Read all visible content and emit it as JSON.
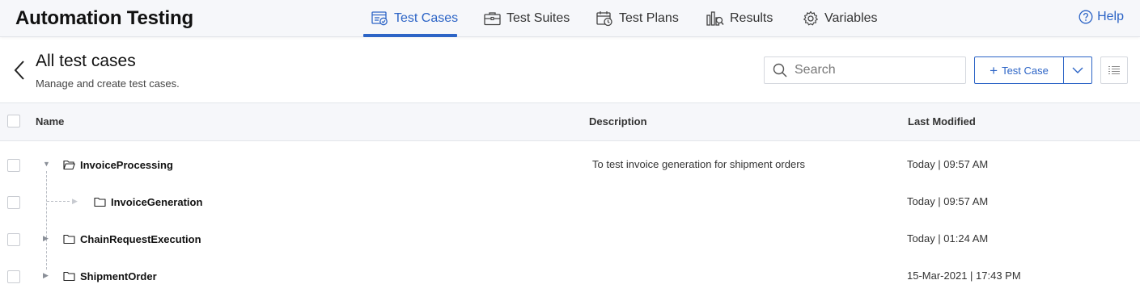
{
  "header": {
    "app_title": "Automation Testing",
    "tabs": [
      {
        "label": "Test Cases",
        "icon": "test-cases-icon",
        "active": true
      },
      {
        "label": "Test Suites",
        "icon": "briefcase-icon",
        "active": false
      },
      {
        "label": "Test Plans",
        "icon": "calendar-clock-icon",
        "active": false
      },
      {
        "label": "Results",
        "icon": "results-icon",
        "active": false
      },
      {
        "label": "Variables",
        "icon": "gear-icon",
        "active": false
      }
    ],
    "help_label": "Help"
  },
  "page": {
    "title": "All test cases",
    "subtitle": "Manage and create test cases."
  },
  "toolbar": {
    "search_placeholder": "Search",
    "add_label": "Test Case"
  },
  "table": {
    "columns": [
      "Name",
      "Description",
      "Last Modified"
    ],
    "rows": [
      {
        "name": "InvoiceProcessing",
        "description": "To test invoice generation for shipment orders",
        "modified": "Today | 09:57 AM",
        "expanded": true,
        "level": 0
      },
      {
        "name": "InvoiceGeneration",
        "description": "",
        "modified": "Today | 09:57 AM",
        "expanded": false,
        "level": 1
      },
      {
        "name": "ChainRequestExecution",
        "description": "",
        "modified": "Today | 01:24 AM",
        "expanded": false,
        "level": 0
      },
      {
        "name": "ShipmentOrder",
        "description": "",
        "modified": "15-Mar-2021 | 17:43 PM",
        "expanded": false,
        "level": 0
      }
    ]
  },
  "colors": {
    "accent": "#2c64c6",
    "header_bg": "#f6f7fa"
  }
}
